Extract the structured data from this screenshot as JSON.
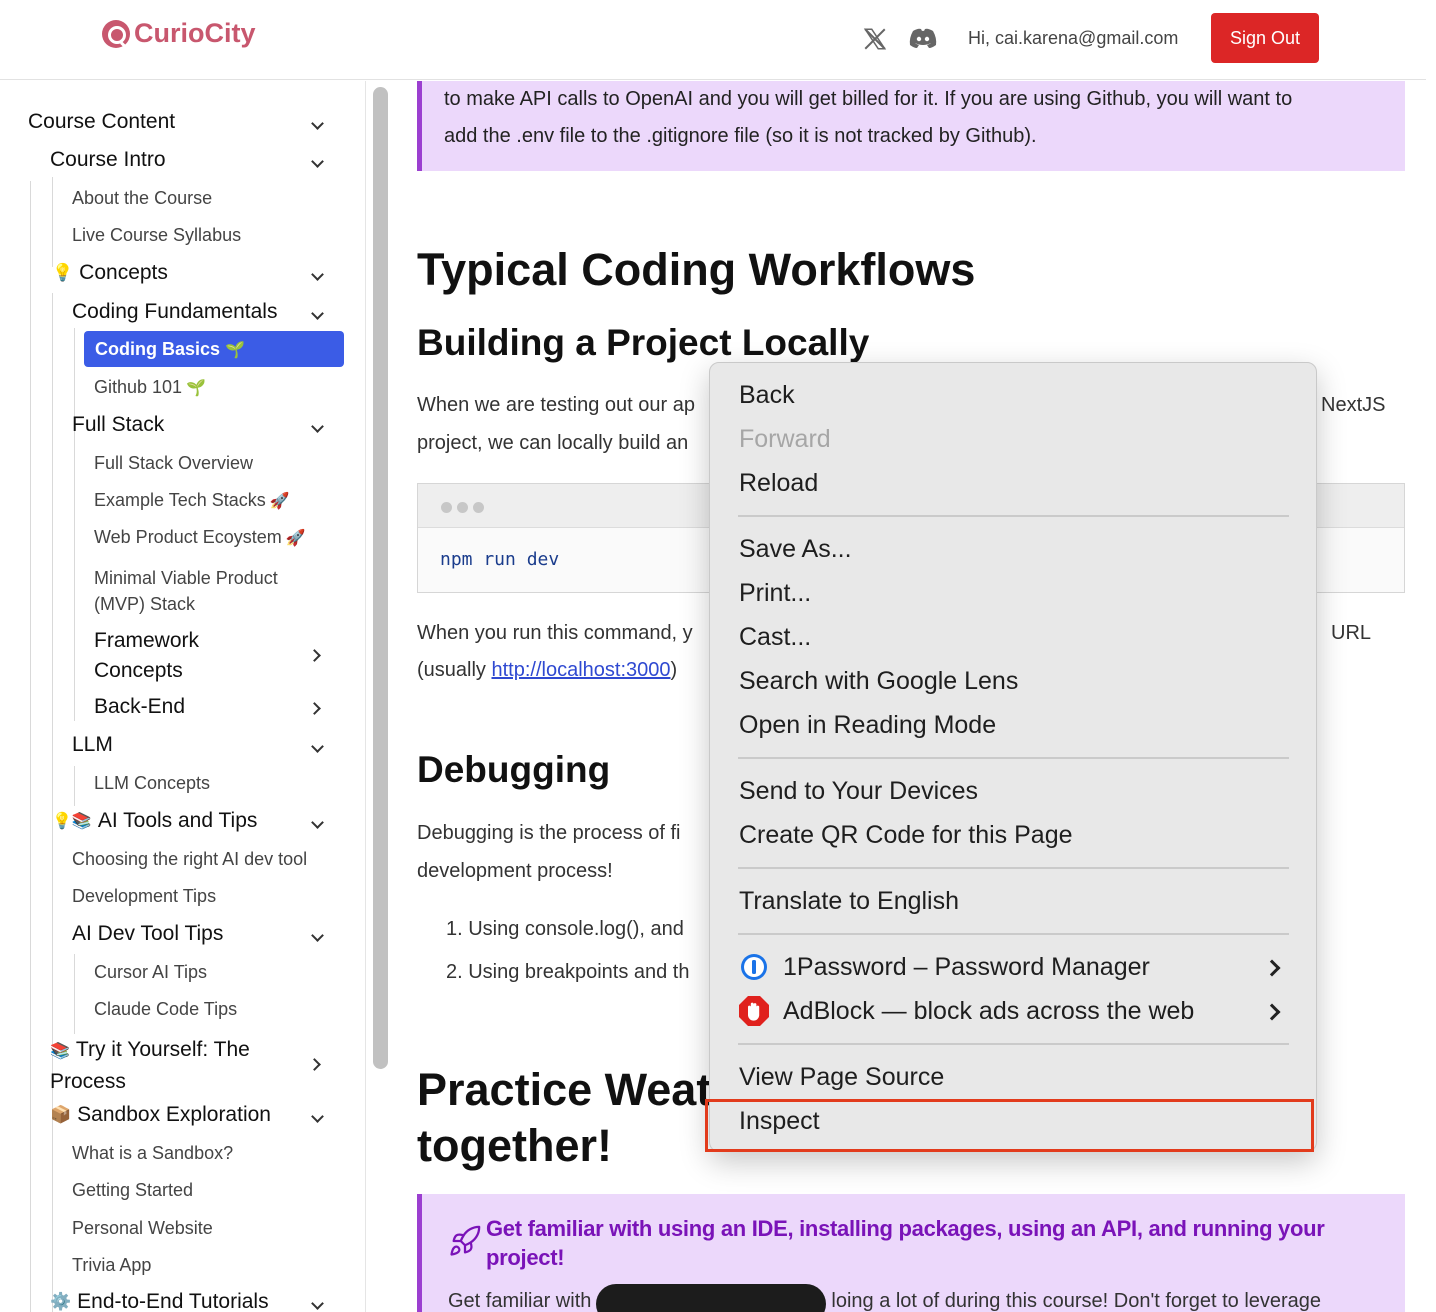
{
  "header": {
    "logo_text": "CurioCity",
    "greeting": "Hi, cai.karena@gmail.com",
    "sign_out_label": "Sign Out",
    "x_icon_glyph": "𝕏",
    "brand_color": "#c8576e",
    "sign_out_color": "#dc2626"
  },
  "sidebar": {
    "course_content": "Course Content",
    "course_intro": "Course Intro",
    "about_course": "About the Course",
    "live_syllabus": "Live Course Syllabus",
    "concepts": "Concepts",
    "coding_fundamentals": "Coding Fundamentals",
    "coding_basics": "Coding Basics",
    "github_101": "Github 101",
    "full_stack": "Full Stack",
    "full_stack_overview": "Full Stack Overview",
    "example_tech_stacks": "Example Tech Stacks",
    "web_product_ecosystem": "Web Product Ecoystem",
    "mvp_stack_line1": "Minimal Viable Product",
    "mvp_stack_line2": "(MVP) Stack",
    "framework_concepts_line1": "Framework",
    "framework_concepts_line2": "Concepts",
    "back_end": "Back-End",
    "llm": "LLM",
    "llm_concepts": "LLM Concepts",
    "ai_tools_tips": "AI Tools and Tips",
    "choosing_ai_tool": "Choosing the right AI dev tool",
    "development_tips": "Development Tips",
    "ai_dev_tool_tips": "AI Dev Tool Tips",
    "cursor_ai_tips": "Cursor AI Tips",
    "claude_code_tips": "Claude Code Tips",
    "try_it_yourself_line1": "Try it Yourself: The",
    "try_it_yourself_line2": "Process",
    "sandbox_exploration": "Sandbox Exploration",
    "what_is_sandbox": "What is a Sandbox?",
    "getting_started": "Getting Started",
    "personal_website": "Personal Website",
    "trivia_app": "Trivia App",
    "end_to_end": "End-to-End Tutorials",
    "emoji_seedling": "🌱",
    "emoji_rocket": "🚀",
    "emoji_bulb": "💡",
    "emoji_books": "📚",
    "emoji_box": "📦",
    "emoji_gear": "⚙️",
    "active_color": "#3b5ce6"
  },
  "main": {
    "callout_top_line1": "to make API calls to OpenAI and you will get billed for it. If you are using Github, you will want to",
    "callout_top_line2": "add the .env file to the .gitignore file (so it is not tracked by Github).",
    "h_workflows": "Typical Coding Workflows",
    "h_building": "Building a Project Locally",
    "p_building_1a": "When we are testing out our ap",
    "p_building_1b": "NextJS",
    "p_building_2": "project, we can locally build an",
    "code": "npm run dev",
    "p_run_1a": "When you run this command, y",
    "p_run_1b": "URL",
    "p_run_2a": "(usually ",
    "p_run_link": "http://localhost:3000",
    "p_run_2b": ")",
    "h_debugging": "Debugging",
    "p_debug_1": "Debugging is the process of fi",
    "p_debug_2": "development process!",
    "li_1": "1. Using console.log(), and",
    "li_2": "2. Using breakpoints and th",
    "h_practice_1": "Practice Weat",
    "h_practice_2": "together!",
    "callout_title": "Get familiar with using an IDE, installing packages, using an API, and running your project!",
    "callout_body_a": "Get familiar with",
    "callout_body_b": "loing a lot of during this course! Don't forget to leverage",
    "callout_color": "#ecd8fb",
    "callout_accent": "#9b3fd0"
  },
  "context_menu": {
    "back": "Back",
    "forward": "Forward",
    "reload": "Reload",
    "save_as": "Save As...",
    "print": "Print...",
    "cast": "Cast...",
    "search_lens": "Search with Google Lens",
    "reading_mode": "Open in Reading Mode",
    "send_devices": "Send to Your Devices",
    "qr_code": "Create QR Code for this Page",
    "translate": "Translate to English",
    "onepassword": "1Password – Password Manager",
    "adblock": "AdBlock — block ads across the web",
    "view_source": "View Page Source",
    "inspect": "Inspect",
    "highlight_color": "#e23b1c"
  }
}
